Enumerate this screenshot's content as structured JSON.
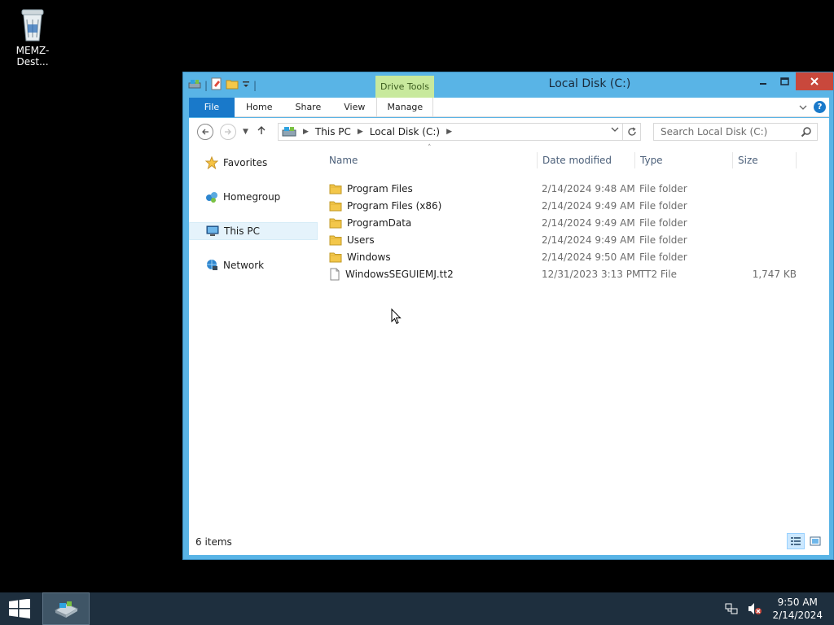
{
  "desktop": {
    "recycle_label": "MEMZ-Dest..."
  },
  "window": {
    "title": "Local Disk (C:)",
    "context_tab": "Drive Tools",
    "ribbon_tabs": {
      "file": "File",
      "home": "Home",
      "share": "Share",
      "view": "View",
      "manage": "Manage"
    },
    "help": "?",
    "address": {
      "segments": [
        "This PC",
        "Local Disk (C:)"
      ]
    },
    "search_placeholder": "Search Local Disk (C:)",
    "nav": {
      "favorites": "Favorites",
      "homegroup": "Homegroup",
      "this_pc": "This PC",
      "network": "Network"
    },
    "columns": {
      "name": "Name",
      "date": "Date modified",
      "type": "Type",
      "size": "Size"
    },
    "files": [
      {
        "name": "Program Files",
        "date": "2/14/2024 9:48 AM",
        "type": "File folder",
        "size": "",
        "icon": "folder-icon"
      },
      {
        "name": "Program Files (x86)",
        "date": "2/14/2024 9:49 AM",
        "type": "File folder",
        "size": "",
        "icon": "folder-icon"
      },
      {
        "name": "ProgramData",
        "date": "2/14/2024 9:49 AM",
        "type": "File folder",
        "size": "",
        "icon": "folder-icon"
      },
      {
        "name": "Users",
        "date": "2/14/2024 9:49 AM",
        "type": "File folder",
        "size": "",
        "icon": "folder-icon"
      },
      {
        "name": "Windows",
        "date": "2/14/2024 9:50 AM",
        "type": "File folder",
        "size": "",
        "icon": "folder-icon"
      },
      {
        "name": "WindowsSEGUIEMJ.tt2",
        "date": "12/31/2023 3:13 PM",
        "type": "TT2 File",
        "size": "1,747 KB",
        "icon": "file-icon"
      }
    ],
    "status": "6 items"
  },
  "taskbar": {
    "time": "9:50 AM",
    "date": "2/14/2024"
  },
  "colors": {
    "accent": "#1979ca",
    "window_frame": "#59b4e6",
    "drive_tools": "#c8e99d",
    "close": "#c9483c",
    "taskbar": "#1e2f3e"
  }
}
